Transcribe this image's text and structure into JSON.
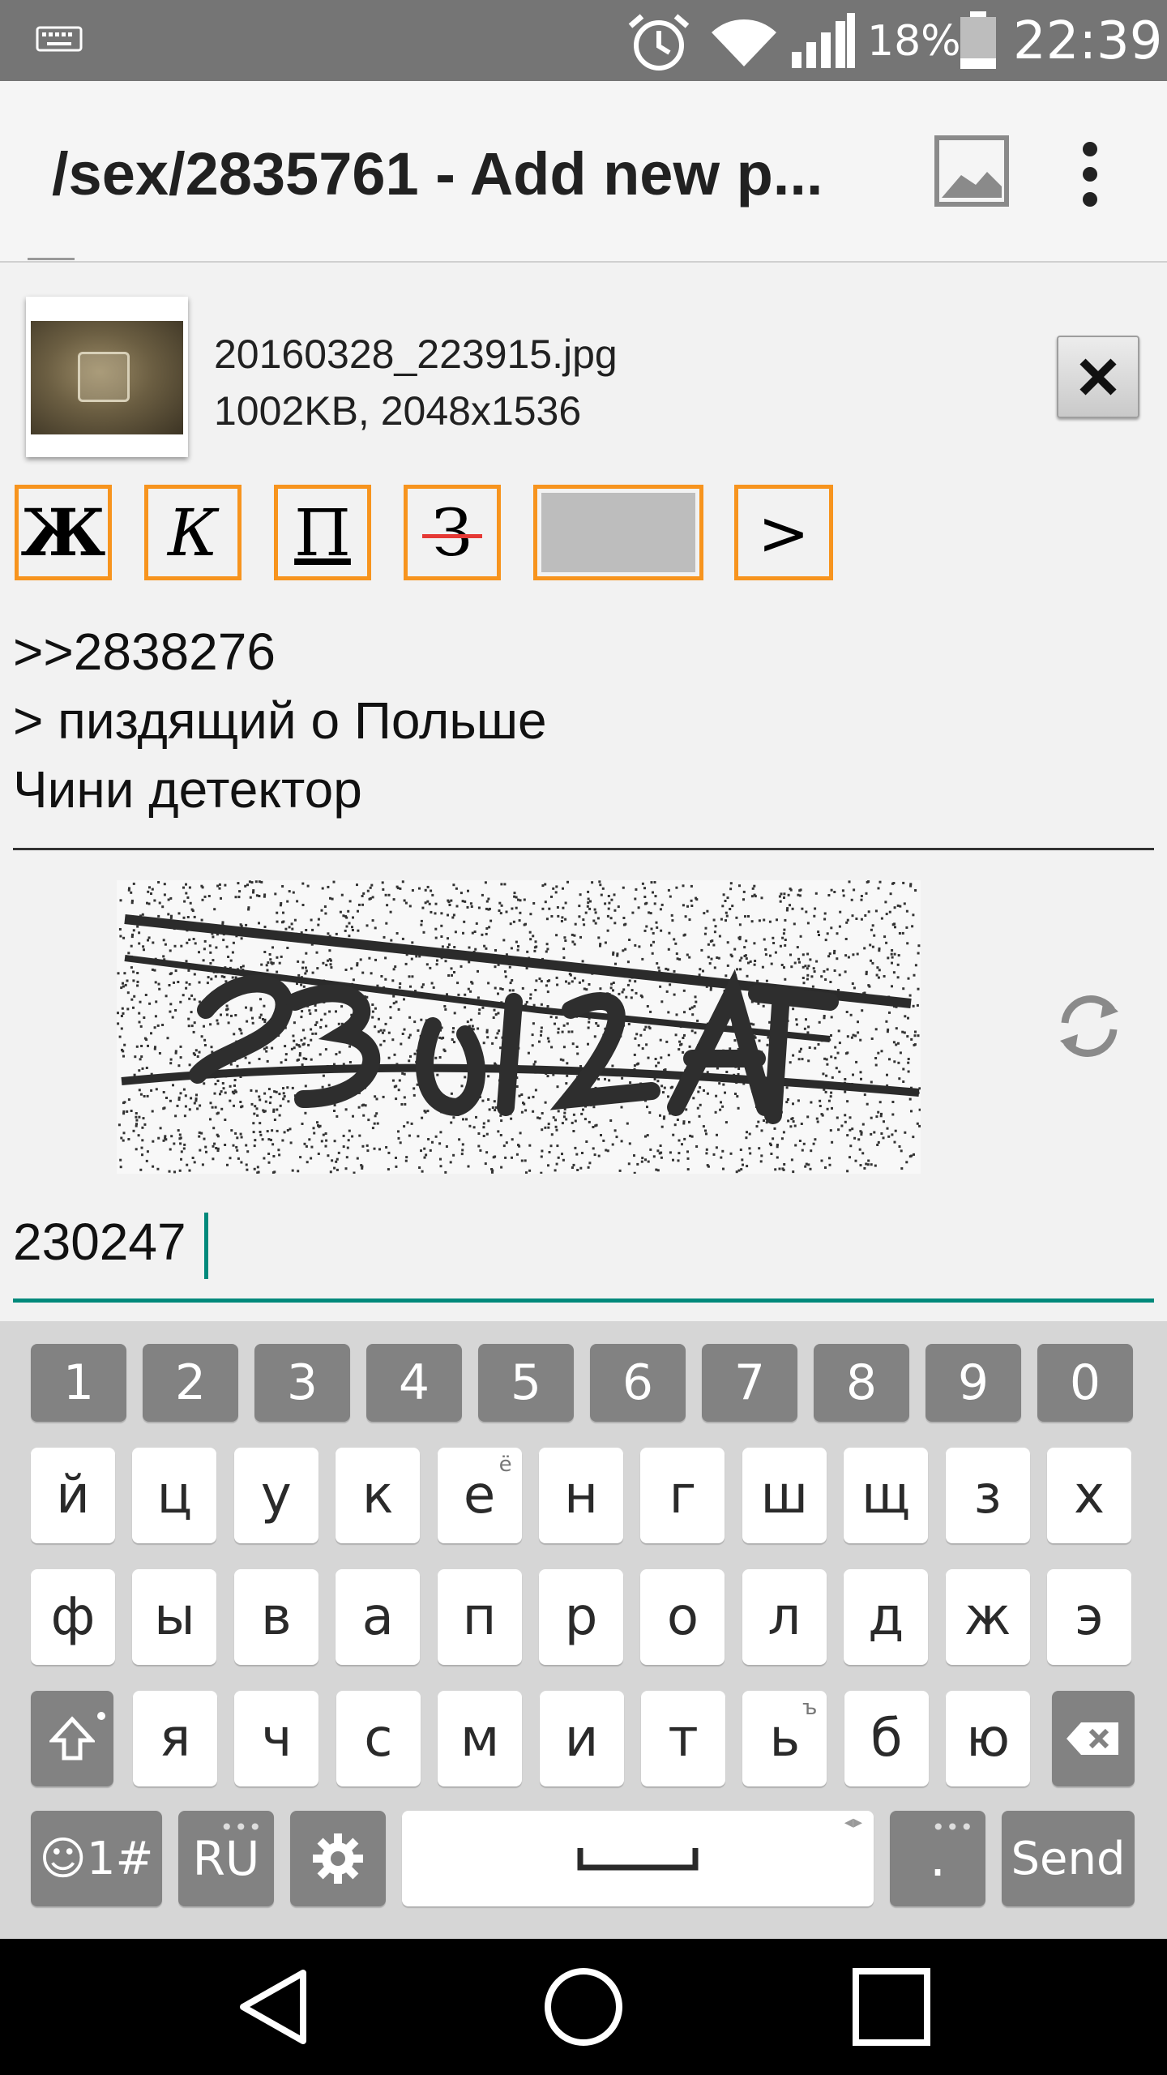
{
  "status_bar": {
    "battery_percent": "18%",
    "time": "22:39",
    "icons": [
      "keyboard-icon",
      "alarm-icon",
      "wifi-icon",
      "signal-icon",
      "battery-icon"
    ]
  },
  "app_bar": {
    "title": "/sex/2835761 - Add new p...",
    "actions": [
      "image-icon",
      "more-vert-icon"
    ]
  },
  "attachment": {
    "file_name": "20160328_223915.jpg",
    "file_meta": "1002KB, 2048x1536"
  },
  "format_toolbar": {
    "bold": "Ж",
    "italic": "К",
    "underline": "П",
    "strike": "З",
    "quote": ">",
    "accent_color": "#f7941e"
  },
  "comment": {
    "lines": [
      ">>2838276",
      "> пиздящий о Польше",
      "Чини детектор"
    ]
  },
  "captcha": {
    "input_value": "230247",
    "accent_color": "#00897b"
  },
  "keyboard": {
    "number_row": [
      "1",
      "2",
      "3",
      "4",
      "5",
      "6",
      "7",
      "8",
      "9",
      "0"
    ],
    "row1": [
      "й",
      "ц",
      "у",
      "к",
      "е",
      "н",
      "г",
      "ш",
      "щ",
      "з",
      "х"
    ],
    "row1_hint_e": "ё",
    "row2": [
      "ф",
      "ы",
      "в",
      "а",
      "п",
      "р",
      "о",
      "л",
      "д",
      "ж",
      "э"
    ],
    "row3": [
      "я",
      "ч",
      "с",
      "м",
      "и",
      "т",
      "ь",
      "б",
      "ю"
    ],
    "row3_hint_soft": "ъ",
    "symbols_label": "☺1#",
    "language_label": "RU",
    "period_label": ".",
    "send_label": "Send"
  }
}
